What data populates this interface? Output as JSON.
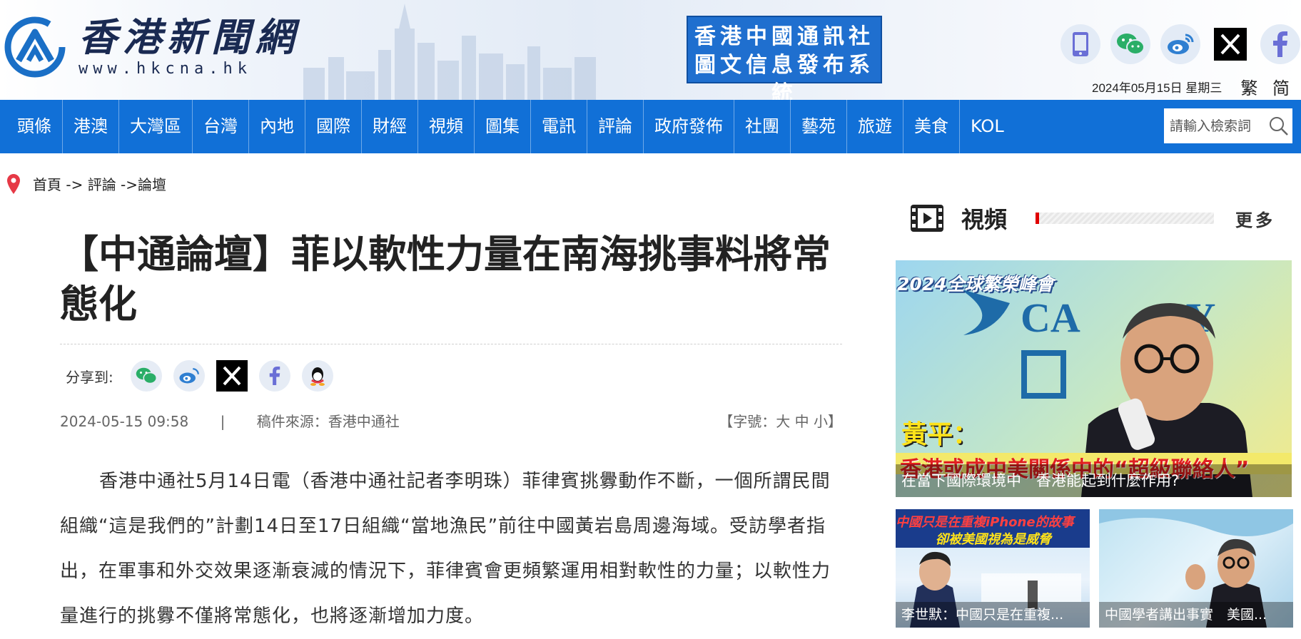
{
  "header": {
    "logo_cn": "香港新聞網",
    "logo_url": "www.hkcna.hk",
    "cns_line1": "香港中國通訊社",
    "cns_line2": "圖文信息發布系統",
    "social_icons": [
      "mobile-icon",
      "wechat-icon",
      "weibo-icon",
      "x-icon",
      "facebook-icon"
    ],
    "date": "2024年05月15日 星期三",
    "lang_trad": "繁",
    "lang_simp": "简"
  },
  "nav": {
    "items": [
      "頭條",
      "港澳",
      "大灣區",
      "台灣",
      "內地",
      "國際",
      "財經",
      "視頻",
      "圖集",
      "電訊",
      "評論",
      "政府發佈",
      "社團",
      "藝苑",
      "旅遊",
      "美食",
      "KOL"
    ],
    "search_placeholder": "請輸入檢索詞"
  },
  "breadcrumb": {
    "text": "首頁 -> 評論 ->論壇"
  },
  "article": {
    "title": "【中通論壇】菲以軟性力量在南海挑事料將常態化",
    "share_label": "分享到:",
    "share_icons": [
      "wechat-icon",
      "weibo-icon",
      "x-icon",
      "facebook-icon",
      "qq-icon"
    ],
    "datetime": "2024-05-15 09:58",
    "separator": "|",
    "source": "稿件來源：香港中通社",
    "font_size_label": "【字號：大 中 小】",
    "body": "香港中通社5月14日電（香港中通社記者李明珠）菲律賓挑釁動作不斷，一個所謂民間組織“這是我們的”計劃14日至17日組織“當地漁民”前往中國黃岩島周邊海域。受訪學者指出，在軍事和外交效果逐漸衰減的情況下，菲律賓會更頻繁運用相對軟性的力量；以軟性力量進行的挑釁不僅將常態化，也將逐漸增加力度。"
  },
  "sidebar": {
    "title": "視頻",
    "more": "更多",
    "main_video": {
      "overlay_top": "2024全球繁榮峰會",
      "overlay_name": "黃平：",
      "overlay_sub": "香港或成中美關係中的“超級聯絡人”",
      "caption": "在當下國際環境中　香港能起到什麼作用?"
    },
    "videos": [
      {
        "overlay": "中國只是在重複iPhone的故事",
        "overlay2": "卻被美國視為是威脅",
        "caption": "李世默：中國只是在重複..."
      },
      {
        "caption": "中國學者講出事實　美國..."
      }
    ]
  },
  "colors": {
    "nav_bg": "#1170d7",
    "cns_bg": "#1f6fcf",
    "accent_red": "#e00000"
  }
}
